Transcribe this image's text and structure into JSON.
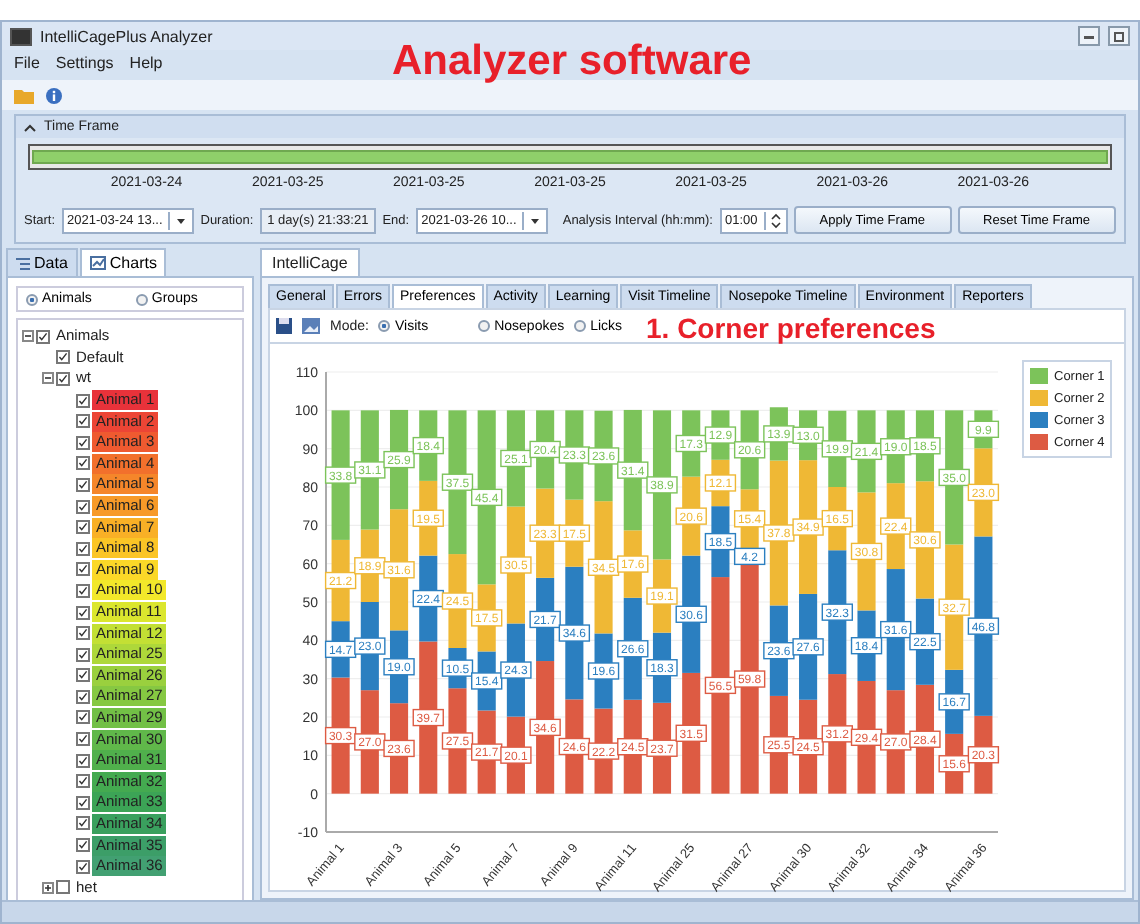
{
  "window": {
    "title": "IntelliCagePlus Analyzer"
  },
  "heading": "Analyzer software",
  "menu": [
    "File",
    "Settings",
    "Help"
  ],
  "time_frame": {
    "title": "Time Frame",
    "expanded": true,
    "level": 1,
    "dates": [
      "2021-03-24",
      "2021-03-25",
      "2021-03-25",
      "2021-03-25",
      "2021-03-25",
      "2021-03-26",
      "2021-03-26"
    ],
    "start_label": "Start:",
    "start": "2021-03-24 13...",
    "duration_label": "Duration:",
    "duration": "1 day(s) 21:33:21",
    "end_label": "End:",
    "end": "2021-03-26 10...",
    "interval_label": "Analysis Interval (hh:mm):",
    "interval": "01:00",
    "buttons": [
      "Apply Time Frame",
      "Reset Time Frame"
    ]
  },
  "left_tabs": [
    {
      "label": "Data",
      "selected": false
    },
    {
      "label": "Charts",
      "selected": true
    }
  ],
  "group_by": [
    {
      "label": "Animals",
      "selected": true
    },
    {
      "label": "Groups",
      "selected": false
    }
  ],
  "tree": [
    {
      "label": "Animals",
      "checked": true,
      "expanded": true,
      "children": [
        {
          "label": "Default",
          "checked": true
        },
        {
          "label": "wt",
          "checked": true,
          "expanded": true,
          "children": [
            {
              "label": "Animal 1",
              "checked": true,
              "color": "#e8323a"
            },
            {
              "label": "Animal 2",
              "checked": true,
              "color": "#ec4535"
            },
            {
              "label": "Animal 3",
              "checked": true,
              "color": "#ef5a30"
            },
            {
              "label": "Animal 4",
              "checked": true,
              "color": "#f2702c"
            },
            {
              "label": "Animal 5",
              "checked": true,
              "color": "#f5862a"
            },
            {
              "label": "Animal 6",
              "checked": true,
              "color": "#f79a28"
            },
            {
              "label": "Animal 7",
              "checked": true,
              "color": "#f9b026"
            },
            {
              "label": "Animal 8",
              "checked": true,
              "color": "#fbc526"
            },
            {
              "label": "Animal 9",
              "checked": true,
              "color": "#fbd828"
            },
            {
              "label": "Animal 10",
              "checked": true,
              "color": "#f2e82a"
            },
            {
              "label": "Animal 11",
              "checked": true,
              "color": "#dbe62e"
            },
            {
              "label": "Animal 12",
              "checked": true,
              "color": "#c3e034"
            },
            {
              "label": "Animal 25",
              "checked": true,
              "color": "#aed83a"
            },
            {
              "label": "Animal 26",
              "checked": true,
              "color": "#9ad03e"
            },
            {
              "label": "Animal 27",
              "checked": true,
              "color": "#86c842"
            },
            {
              "label": "Animal 29",
              "checked": true,
              "color": "#72c046"
            },
            {
              "label": "Animal 30",
              "checked": true,
              "color": "#60b84a"
            },
            {
              "label": "Animal 31",
              "checked": true,
              "color": "#50b04c"
            },
            {
              "label": "Animal 32",
              "checked": true,
              "color": "#44aa50"
            },
            {
              "label": "Animal 33",
              "checked": true,
              "color": "#3ca456"
            },
            {
              "label": "Animal 34",
              "checked": true,
              "color": "#3aa05e"
            },
            {
              "label": "Animal 35",
              "checked": true,
              "color": "#3c9e68"
            },
            {
              "label": "Animal 36",
              "checked": true,
              "color": "#42a072"
            }
          ]
        },
        {
          "label": "het",
          "checked": false,
          "expanded": false
        }
      ]
    }
  ],
  "main_tab": "IntelliCage",
  "sub_tabs": [
    {
      "label": "General",
      "selected": false
    },
    {
      "label": "Errors",
      "selected": false
    },
    {
      "label": "Preferences",
      "selected": true
    },
    {
      "label": "Activity",
      "selected": false
    },
    {
      "label": "Learning",
      "selected": false
    },
    {
      "label": "Visit Timeline",
      "selected": false
    },
    {
      "label": "Nosepoke Timeline",
      "selected": false
    },
    {
      "label": "Environment",
      "selected": false
    },
    {
      "label": "Reporters",
      "selected": false
    }
  ],
  "mode_label": "Mode:",
  "modes": [
    {
      "label": "Visits",
      "selected": true
    },
    {
      "label": "Nosepokes",
      "selected": false
    },
    {
      "label": "Licks",
      "selected": false
    }
  ],
  "caption": "1. Corner preferences",
  "chart_data": {
    "type": "bar",
    "stacked": true,
    "grid": true,
    "legend": "right",
    "categories": [
      "Animal 1",
      null,
      "Animal 3",
      null,
      "Animal 5",
      null,
      "Animal 7",
      null,
      "Animal 9",
      null,
      "Animal 11",
      null,
      "Animal 25",
      null,
      "Animal 27",
      null,
      "Animal 30",
      null,
      "Animal 32",
      null,
      "Animal 34",
      null,
      "Animal 36"
    ],
    "ylim": [
      -10,
      110
    ],
    "yticks": [
      -10,
      0,
      10,
      20,
      30,
      40,
      50,
      60,
      70,
      80,
      90,
      100,
      110
    ],
    "series": [
      {
        "name": "Corner 4",
        "color": "#dd5b43",
        "values": [
          30.3,
          27.0,
          23.6,
          39.7,
          27.5,
          21.7,
          20.1,
          34.6,
          24.6,
          22.2,
          24.5,
          23.7,
          31.5,
          56.5,
          59.8,
          25.5,
          24.5,
          31.2,
          29.4,
          27.0,
          28.4,
          15.6,
          20.3
        ],
        "value_labels": [
          "30.3",
          "27.0",
          "23.6",
          "39.7",
          "27.5",
          "21.7",
          "20.1",
          "34.6",
          "24.6",
          "22.2",
          "24.5",
          "23.7",
          "31.5",
          "56.5",
          "59.8",
          "25.5",
          "24.5",
          "31.2",
          "29.4",
          "27.0",
          "28.4",
          "15.6",
          "20.3"
        ]
      },
      {
        "name": "Corner 3",
        "color": "#2b7fc0",
        "values": [
          14.7,
          23.0,
          19.0,
          22.4,
          10.5,
          15.4,
          24.3,
          21.7,
          34.6,
          19.6,
          26.6,
          18.3,
          30.6,
          18.5,
          4.2,
          23.6,
          27.6,
          32.3,
          18.4,
          31.6,
          22.5,
          16.7,
          46.8
        ],
        "value_labels": [
          "14.7",
          "23.0",
          "19.0",
          "22.4",
          "10.5",
          "15.4",
          "24.3",
          "21.7",
          "34.6",
          "19.6",
          "26.6",
          "18.3",
          "30.6",
          "18.5",
          "4.2",
          "23.6",
          "27.6",
          "32.3",
          "18.4",
          "31.6",
          "22.5",
          "16.7",
          "46.8"
        ]
      },
      {
        "name": "Corner 2",
        "color": "#efb835",
        "values": [
          21.2,
          18.9,
          31.6,
          19.5,
          24.5,
          17.5,
          30.5,
          23.3,
          17.5,
          34.5,
          17.6,
          19.1,
          20.6,
          12.1,
          15.4,
          37.8,
          34.9,
          16.5,
          30.8,
          22.4,
          30.6,
          32.7,
          23.0
        ],
        "value_labels": [
          "21.2",
          "18.9",
          "31.6",
          "19.5",
          "24.5",
          "17.5",
          "30.5",
          "23.3",
          "17.5",
          "34.5",
          "17.6",
          "19.1",
          "20.6",
          "12.1",
          "15.4",
          "37.8",
          "34.9",
          "16.5",
          "30.8",
          "22.4",
          "30.6",
          "32.7",
          "23.0"
        ]
      },
      {
        "name": "Corner 1",
        "color": "#7cc35a",
        "values": [
          33.8,
          31.1,
          25.9,
          18.4,
          37.5,
          45.4,
          25.1,
          20.4,
          23.3,
          23.6,
          31.4,
          38.9,
          17.3,
          12.9,
          20.6,
          13.9,
          13.0,
          19.9,
          21.4,
          19.0,
          18.5,
          35.0,
          9.9
        ],
        "value_labels": [
          "33.8",
          "31.1",
          "25.9",
          "18.4",
          "37.5",
          "45.4",
          "25.1",
          "20.4",
          "23.3",
          "23.6",
          "31.4",
          "38.9",
          "17.3",
          "12.9",
          "20.6",
          "13.9",
          "13.0",
          "19.9",
          "21.4",
          "19.0",
          "18.5",
          "35.0",
          "9.9"
        ]
      }
    ]
  }
}
